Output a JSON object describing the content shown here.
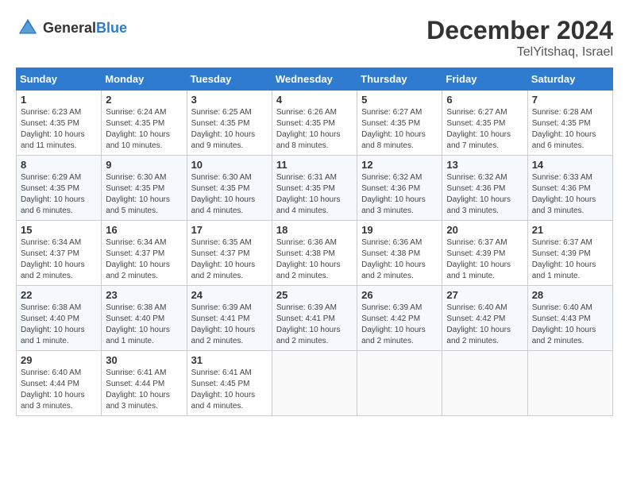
{
  "logo": {
    "text1": "General",
    "text2": "Blue"
  },
  "title": "December 2024",
  "location": "TelYitshaq, Israel",
  "days_header": [
    "Sunday",
    "Monday",
    "Tuesday",
    "Wednesday",
    "Thursday",
    "Friday",
    "Saturday"
  ],
  "weeks": [
    [
      {
        "num": "1",
        "sunrise": "6:23 AM",
        "sunset": "4:35 PM",
        "daylight": "10 hours and 11 minutes."
      },
      {
        "num": "2",
        "sunrise": "6:24 AM",
        "sunset": "4:35 PM",
        "daylight": "10 hours and 10 minutes."
      },
      {
        "num": "3",
        "sunrise": "6:25 AM",
        "sunset": "4:35 PM",
        "daylight": "10 hours and 9 minutes."
      },
      {
        "num": "4",
        "sunrise": "6:26 AM",
        "sunset": "4:35 PM",
        "daylight": "10 hours and 8 minutes."
      },
      {
        "num": "5",
        "sunrise": "6:27 AM",
        "sunset": "4:35 PM",
        "daylight": "10 hours and 8 minutes."
      },
      {
        "num": "6",
        "sunrise": "6:27 AM",
        "sunset": "4:35 PM",
        "daylight": "10 hours and 7 minutes."
      },
      {
        "num": "7",
        "sunrise": "6:28 AM",
        "sunset": "4:35 PM",
        "daylight": "10 hours and 6 minutes."
      }
    ],
    [
      {
        "num": "8",
        "sunrise": "6:29 AM",
        "sunset": "4:35 PM",
        "daylight": "10 hours and 6 minutes."
      },
      {
        "num": "9",
        "sunrise": "6:30 AM",
        "sunset": "4:35 PM",
        "daylight": "10 hours and 5 minutes."
      },
      {
        "num": "10",
        "sunrise": "6:30 AM",
        "sunset": "4:35 PM",
        "daylight": "10 hours and 4 minutes."
      },
      {
        "num": "11",
        "sunrise": "6:31 AM",
        "sunset": "4:35 PM",
        "daylight": "10 hours and 4 minutes."
      },
      {
        "num": "12",
        "sunrise": "6:32 AM",
        "sunset": "4:36 PM",
        "daylight": "10 hours and 3 minutes."
      },
      {
        "num": "13",
        "sunrise": "6:32 AM",
        "sunset": "4:36 PM",
        "daylight": "10 hours and 3 minutes."
      },
      {
        "num": "14",
        "sunrise": "6:33 AM",
        "sunset": "4:36 PM",
        "daylight": "10 hours and 3 minutes."
      }
    ],
    [
      {
        "num": "15",
        "sunrise": "6:34 AM",
        "sunset": "4:37 PM",
        "daylight": "10 hours and 2 minutes."
      },
      {
        "num": "16",
        "sunrise": "6:34 AM",
        "sunset": "4:37 PM",
        "daylight": "10 hours and 2 minutes."
      },
      {
        "num": "17",
        "sunrise": "6:35 AM",
        "sunset": "4:37 PM",
        "daylight": "10 hours and 2 minutes."
      },
      {
        "num": "18",
        "sunrise": "6:36 AM",
        "sunset": "4:38 PM",
        "daylight": "10 hours and 2 minutes."
      },
      {
        "num": "19",
        "sunrise": "6:36 AM",
        "sunset": "4:38 PM",
        "daylight": "10 hours and 2 minutes."
      },
      {
        "num": "20",
        "sunrise": "6:37 AM",
        "sunset": "4:39 PM",
        "daylight": "10 hours and 1 minute."
      },
      {
        "num": "21",
        "sunrise": "6:37 AM",
        "sunset": "4:39 PM",
        "daylight": "10 hours and 1 minute."
      }
    ],
    [
      {
        "num": "22",
        "sunrise": "6:38 AM",
        "sunset": "4:40 PM",
        "daylight": "10 hours and 1 minute."
      },
      {
        "num": "23",
        "sunrise": "6:38 AM",
        "sunset": "4:40 PM",
        "daylight": "10 hours and 1 minute."
      },
      {
        "num": "24",
        "sunrise": "6:39 AM",
        "sunset": "4:41 PM",
        "daylight": "10 hours and 2 minutes."
      },
      {
        "num": "25",
        "sunrise": "6:39 AM",
        "sunset": "4:41 PM",
        "daylight": "10 hours and 2 minutes."
      },
      {
        "num": "26",
        "sunrise": "6:39 AM",
        "sunset": "4:42 PM",
        "daylight": "10 hours and 2 minutes."
      },
      {
        "num": "27",
        "sunrise": "6:40 AM",
        "sunset": "4:42 PM",
        "daylight": "10 hours and 2 minutes."
      },
      {
        "num": "28",
        "sunrise": "6:40 AM",
        "sunset": "4:43 PM",
        "daylight": "10 hours and 2 minutes."
      }
    ],
    [
      {
        "num": "29",
        "sunrise": "6:40 AM",
        "sunset": "4:44 PM",
        "daylight": "10 hours and 3 minutes."
      },
      {
        "num": "30",
        "sunrise": "6:41 AM",
        "sunset": "4:44 PM",
        "daylight": "10 hours and 3 minutes."
      },
      {
        "num": "31",
        "sunrise": "6:41 AM",
        "sunset": "4:45 PM",
        "daylight": "10 hours and 4 minutes."
      },
      null,
      null,
      null,
      null
    ]
  ]
}
